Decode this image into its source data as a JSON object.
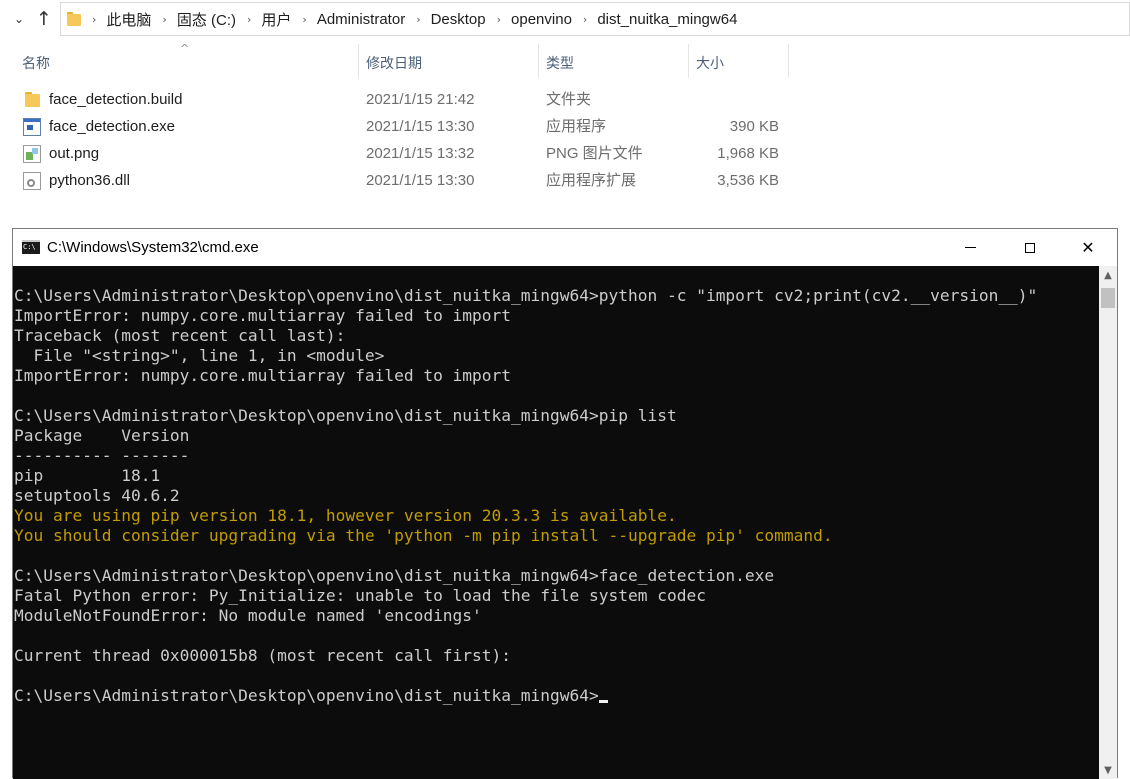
{
  "explorer": {
    "nav": {
      "chevron_glyph": "⌄",
      "up_glyph": "↑"
    },
    "breadcrumbs": [
      "此电脑",
      "固态 (C:)",
      "用户",
      "Administrator",
      "Desktop",
      "openvino",
      "dist_nuitka_mingw64"
    ],
    "breadcrumb_sep": "›",
    "columns": {
      "name": "名称",
      "date": "修改日期",
      "type": "类型",
      "size": "大小",
      "sort_glyph": "^"
    },
    "files": [
      {
        "name": "face_detection.build",
        "date": "2021/1/15 21:42",
        "type": "文件夹",
        "size": "",
        "icon": "folder-icon"
      },
      {
        "name": "face_detection.exe",
        "date": "2021/1/15 13:30",
        "type": "应用程序",
        "size": "390 KB",
        "icon": "exe-icon"
      },
      {
        "name": "out.png",
        "date": "2021/1/15 13:32",
        "type": "PNG 图片文件",
        "size": "1,968 KB",
        "icon": "png-icon"
      },
      {
        "name": "python36.dll",
        "date": "2021/1/15 13:30",
        "type": "应用程序扩展",
        "size": "3,536 KB",
        "icon": "dll-icon"
      }
    ]
  },
  "cmd": {
    "title": "C:\\Windows\\System32\\cmd.exe",
    "buttons": {
      "close_glyph": "✕"
    },
    "scroll": {
      "up_glyph": "▲",
      "down_glyph": "▼"
    },
    "colors": {
      "background": "#0c0c0c",
      "text": "#cccccc",
      "warning": "#c19c00"
    },
    "lines": [
      {
        "text": "C:\\Users\\Administrator\\Desktop\\openvino\\dist_nuitka_mingw64>python -c \"import cv2;print(cv2.__version__)\"",
        "kind": "normal"
      },
      {
        "text": "ImportError: numpy.core.multiarray failed to import",
        "kind": "normal"
      },
      {
        "text": "Traceback (most recent call last):",
        "kind": "normal"
      },
      {
        "text": "  File \"<string>\", line 1, in <module>",
        "kind": "normal"
      },
      {
        "text": "ImportError: numpy.core.multiarray failed to import",
        "kind": "normal"
      },
      {
        "text": "",
        "kind": "normal"
      },
      {
        "text": "C:\\Users\\Administrator\\Desktop\\openvino\\dist_nuitka_mingw64>pip list",
        "kind": "normal"
      },
      {
        "text": "Package    Version",
        "kind": "normal"
      },
      {
        "text": "---------- -------",
        "kind": "normal"
      },
      {
        "text": "pip        18.1",
        "kind": "normal"
      },
      {
        "text": "setuptools 40.6.2",
        "kind": "normal"
      },
      {
        "text": "You are using pip version 18.1, however version 20.3.3 is available.",
        "kind": "warn"
      },
      {
        "text": "You should consider upgrading via the 'python -m pip install --upgrade pip' command.",
        "kind": "warn"
      },
      {
        "text": "",
        "kind": "normal"
      },
      {
        "text": "C:\\Users\\Administrator\\Desktop\\openvino\\dist_nuitka_mingw64>face_detection.exe",
        "kind": "normal"
      },
      {
        "text": "Fatal Python error: Py_Initialize: unable to load the file system codec",
        "kind": "normal"
      },
      {
        "text": "ModuleNotFoundError: No module named 'encodings'",
        "kind": "normal"
      },
      {
        "text": "",
        "kind": "normal"
      },
      {
        "text": "Current thread 0x000015b8 (most recent call first):",
        "kind": "normal"
      },
      {
        "text": "",
        "kind": "normal"
      },
      {
        "text": "C:\\Users\\Administrator\\Desktop\\openvino\\dist_nuitka_mingw64>",
        "kind": "prompt"
      }
    ]
  }
}
